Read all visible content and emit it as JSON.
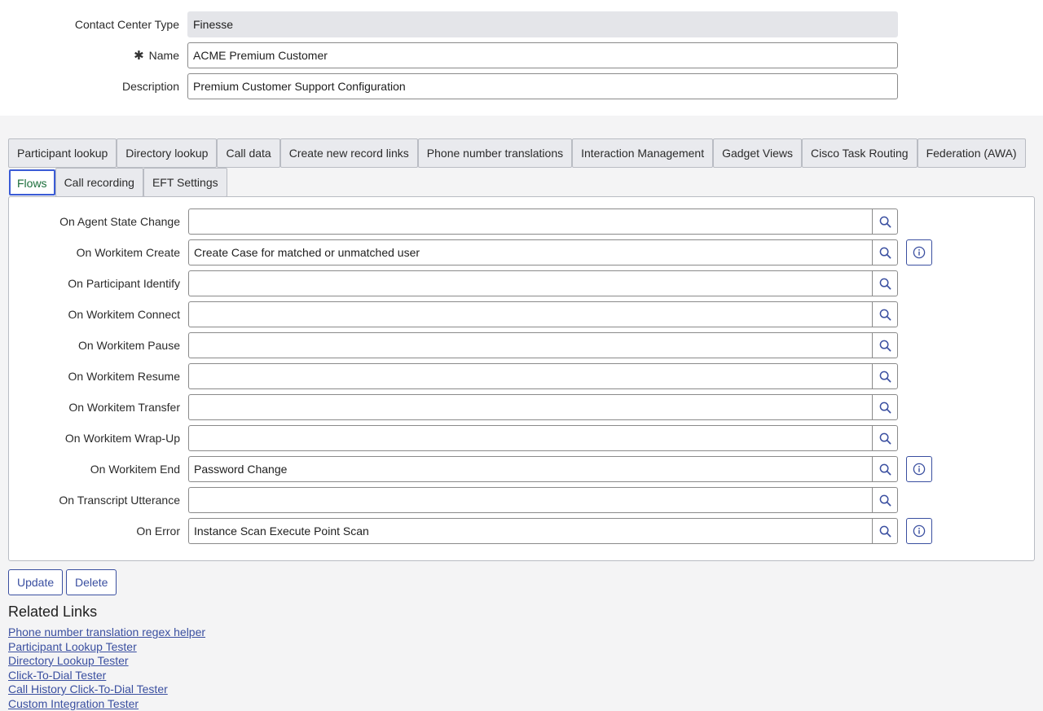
{
  "header_fields": {
    "contact_center_type": {
      "label": "Contact Center Type",
      "value": "Finesse"
    },
    "name": {
      "required_mark": "✱",
      "label": "Name",
      "value": "ACME Premium Customer"
    },
    "description": {
      "label": "Description",
      "value": "Premium Customer Support Configuration"
    }
  },
  "tabs": {
    "row1": [
      "Participant lookup",
      "Directory lookup",
      "Call data",
      "Create new record links",
      "Phone number translations",
      "Interaction Management",
      "Gadget Views",
      "Cisco Task Routing",
      "Federation (AWA)"
    ],
    "row2": [
      "Flows",
      "Call recording",
      "EFT Settings"
    ],
    "active": "Flows"
  },
  "flows": [
    {
      "label": "On Agent State Change",
      "value": "",
      "has_info": false
    },
    {
      "label": "On Workitem Create",
      "value": "Create Case for matched or unmatched user",
      "has_info": true
    },
    {
      "label": "On Participant Identify",
      "value": "",
      "has_info": false
    },
    {
      "label": "On Workitem Connect",
      "value": "",
      "has_info": false
    },
    {
      "label": "On Workitem Pause",
      "value": "",
      "has_info": false
    },
    {
      "label": "On Workitem Resume",
      "value": "",
      "has_info": false
    },
    {
      "label": "On Workitem Transfer",
      "value": "",
      "has_info": false
    },
    {
      "label": "On Workitem Wrap-Up",
      "value": "",
      "has_info": false
    },
    {
      "label": "On Workitem End",
      "value": "Password Change",
      "has_info": true
    },
    {
      "label": "On Transcript Utterance",
      "value": "",
      "has_info": false
    },
    {
      "label": "On Error",
      "value": "Instance Scan Execute Point Scan",
      "has_info": true
    }
  ],
  "buttons": {
    "update": "Update",
    "delete": "Delete"
  },
  "related": {
    "title": "Related Links",
    "links": [
      "Phone number translation regex helper",
      "Participant Lookup Tester",
      "Directory Lookup Tester",
      "Click-To-Dial Tester",
      "Call History Click-To-Dial Tester",
      "Custom Integration Tester"
    ]
  },
  "icons": {
    "search": "search-icon",
    "info": "info-icon"
  },
  "colors": {
    "accent": "#3a4fa0",
    "active_tab_text": "#1b6e3a",
    "active_tab_border": "#3b5cd6",
    "readonly_bg": "#e4e5e9"
  }
}
